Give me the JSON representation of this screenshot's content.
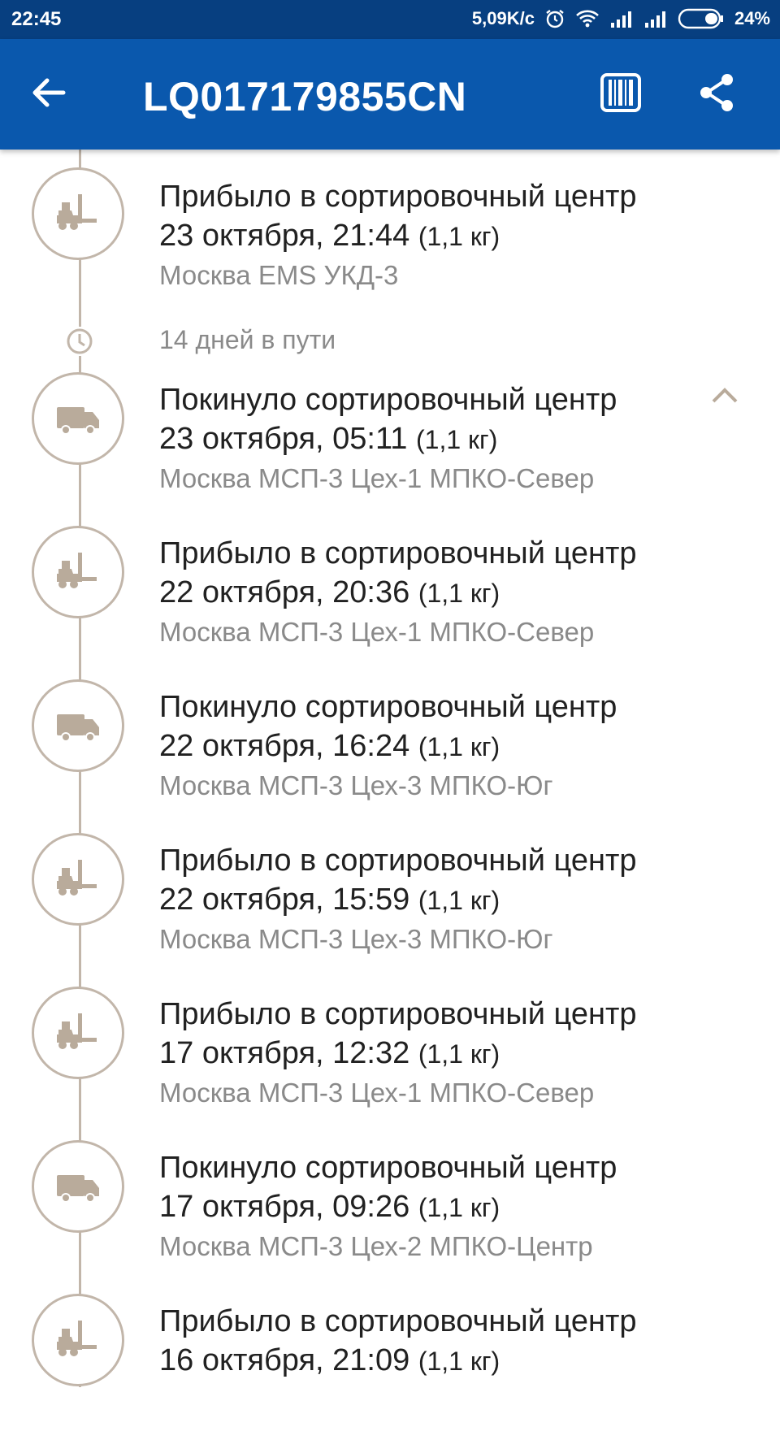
{
  "statusbar": {
    "time": "22:45",
    "network_speed": "5,09K/c",
    "battery": "24%",
    "icons": [
      "alarm-icon",
      "wifi-icon",
      "signal-icon",
      "signal-icon",
      "battery-icon"
    ]
  },
  "appbar": {
    "title": "LQ017179855CN",
    "icons": [
      "back-arrow-icon",
      "barcode-icon",
      "share-icon"
    ],
    "color": "#0a58ad"
  },
  "transit": {
    "text": "14 дней в пути"
  },
  "events": [
    {
      "status": "Прибыло в сортировочный центр",
      "date": "23 октября, 21:44",
      "weight": "(1,1 кг)",
      "location": "Москва EMS УКД-3",
      "icon": "forklift-icon"
    },
    {
      "status": "Покинуло сортировочный центр",
      "date": "23 октября, 05:11",
      "weight": "(1,1 кг)",
      "location": "Москва МСП-3 Цех-1 МПКО-Север",
      "icon": "truck-icon"
    },
    {
      "status": "Прибыло в сортировочный центр",
      "date": "22 октября, 20:36",
      "weight": "(1,1 кг)",
      "location": "Москва МСП-3 Цех-1 МПКО-Север",
      "icon": "forklift-icon"
    },
    {
      "status": "Покинуло сортировочный центр",
      "date": "22 октября, 16:24",
      "weight": "(1,1 кг)",
      "location": "Москва МСП-3 Цех-3 МПКО-Юг",
      "icon": "truck-icon"
    },
    {
      "status": "Прибыло в сортировочный центр",
      "date": "22 октября, 15:59",
      "weight": "(1,1 кг)",
      "location": "Москва МСП-3 Цех-3 МПКО-Юг",
      "icon": "forklift-icon"
    },
    {
      "status": "Прибыло в сортировочный центр",
      "date": "17 октября, 12:32",
      "weight": "(1,1 кг)",
      "location": "Москва МСП-3 Цех-1 МПКО-Север",
      "icon": "forklift-icon"
    },
    {
      "status": "Покинуло сортировочный центр",
      "date": "17 октября, 09:26",
      "weight": "(1,1 кг)",
      "location": "Москва МСП-3 Цех-2 МПКО-Центр",
      "icon": "truck-icon"
    },
    {
      "status": "Прибыло в сортировочный центр",
      "date": "16 октября, 21:09",
      "weight": "(1,1 кг)",
      "location": "",
      "icon": "forklift-icon"
    }
  ]
}
